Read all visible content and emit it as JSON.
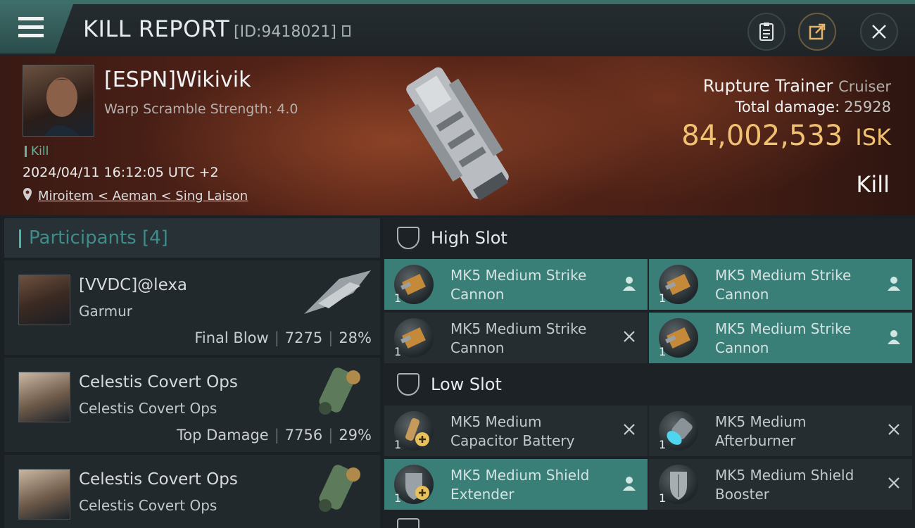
{
  "header": {
    "title": "KILL REPORT",
    "report_id": "[ID:9418021]"
  },
  "victim": {
    "pilot_name": "[ESPN]Wikivik",
    "warp_scramble": "Warp Scramble Strength: 4.0",
    "tag": "Kill",
    "datetime": "2024/04/11 16:12:05 UTC +2",
    "location": "Miroitem < Aeman < Sing Laison",
    "ship_name": "Rupture Trainer",
    "ship_class": "Cruiser",
    "total_damage_label": "Total damage:",
    "total_damage": "25928",
    "isk_value": "84,002,533",
    "isk_unit": "ISK",
    "result": "Kill"
  },
  "participants": {
    "title": "Participants",
    "count": "[4]",
    "rows": [
      {
        "name": "[VVDC]@lexa",
        "ship": "Garmur",
        "stat_label": "Final Blow",
        "damage": "7275",
        "percent": "28%"
      },
      {
        "name": "Celestis Covert Ops",
        "ship": "Celestis Covert Ops",
        "stat_label": "Top Damage",
        "damage": "7756",
        "percent": "29%"
      },
      {
        "name": "Celestis Covert Ops",
        "ship": "Celestis Covert Ops",
        "stat_label": "",
        "damage": "",
        "percent": ""
      }
    ]
  },
  "fitting": {
    "high_slot_label": "High Slot",
    "low_slot_label": "Low Slot",
    "high": [
      {
        "line1": "MK5 Medium Strike",
        "line2": "Cannon",
        "qty": "1",
        "state": "pilot"
      },
      {
        "line1": "MK5 Medium Strike",
        "line2": "Cannon",
        "qty": "1",
        "state": "pilot"
      },
      {
        "line1": "MK5 Medium Strike",
        "line2": "Cannon",
        "qty": "1",
        "state": "destroyed"
      },
      {
        "line1": "MK5 Medium Strike",
        "line2": "Cannon",
        "qty": "1",
        "state": "pilot"
      }
    ],
    "low": [
      {
        "line1": "MK5 Medium",
        "line2": "Capacitor Battery",
        "qty": "1",
        "state": "destroyed"
      },
      {
        "line1": "MK5 Medium",
        "line2": "Afterburner",
        "qty": "1",
        "state": "destroyed"
      },
      {
        "line1": "MK5 Medium Shield",
        "line2": "Extender",
        "qty": "1",
        "state": "pilot"
      },
      {
        "line1": "MK5 Medium Shield",
        "line2": "Booster",
        "qty": "1",
        "state": "destroyed"
      }
    ]
  },
  "colors": {
    "accent": "#3a7e78",
    "isk": "#f0c170",
    "kill_tag": "#6fb09a"
  }
}
